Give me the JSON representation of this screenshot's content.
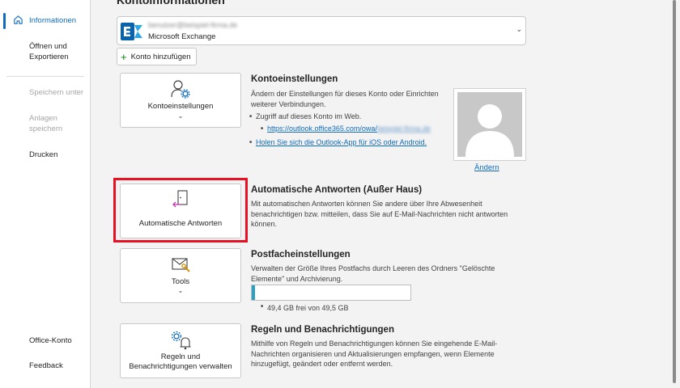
{
  "sidebar": {
    "items": [
      {
        "label": "Informationen",
        "icon": "home-icon",
        "active": true
      },
      {
        "label": "Öffnen und\nExportieren"
      },
      {
        "label": "Speichern unter",
        "disabled": true
      },
      {
        "label": "Anlagen\nspeichern",
        "disabled": true
      },
      {
        "label": "Drucken"
      },
      {
        "label": "Office-Konto"
      },
      {
        "label": "Feedback"
      }
    ]
  },
  "main": {
    "title": "Kontoinformationen",
    "account": {
      "email": "benutzer@beispiel-firma.de",
      "type": "Microsoft Exchange"
    },
    "add_account_label": "Konto hinzufügen",
    "sections": {
      "account_settings": {
        "button_label": "Kontoeinstellungen",
        "title": "Kontoeinstellungen",
        "description": "Ändern der Einstellungen für dieses Konto oder Einrichten weiterer Verbindungen.",
        "web_access_text": "Zugriff auf dieses Konto im Web.",
        "web_link": "https://outlook.office365.com/owa/",
        "web_link_hidden": "beispiel-firma.de",
        "app_link": "Holen Sie sich die Outlook-App für iOS oder Android.",
        "change_label": "Ändern"
      },
      "auto_reply": {
        "button_label": "Automatische Antworten",
        "title": "Automatische Antworten (Außer Haus)",
        "description": "Mit automatischen Antworten können Sie andere über Ihre Abwesenheit benachrichtigen bzw. mitteilen, dass Sie auf E-Mail-Nachrichten nicht antworten können."
      },
      "mailbox": {
        "button_label": "Tools",
        "title": "Postfacheinstellungen",
        "description": "Verwalten der Größe Ihres Postfachs durch Leeren des Ordners \"Gelöschte Elemente\" und Archivierung.",
        "storage_text": "49,4 GB frei von 49,5 GB",
        "storage_used_fraction": 0.02
      },
      "rules": {
        "button_label": "Regeln und\nBenachrichtigungen verwalten",
        "title": "Regeln und Benachrichtigungen",
        "description": "Mithilfe von Regeln und Benachrichtigungen können Sie eingehende E-Mail-Nachrichten organisieren und Aktualisierungen empfangen, wenn Elemente hinzugefügt, geändert oder entfernt werden."
      }
    }
  },
  "colors": {
    "accent": "#0f6cbd",
    "highlight": "#e81123",
    "storage_fill": "#2aa0c6",
    "exchange_blue": "#0a64ad"
  }
}
